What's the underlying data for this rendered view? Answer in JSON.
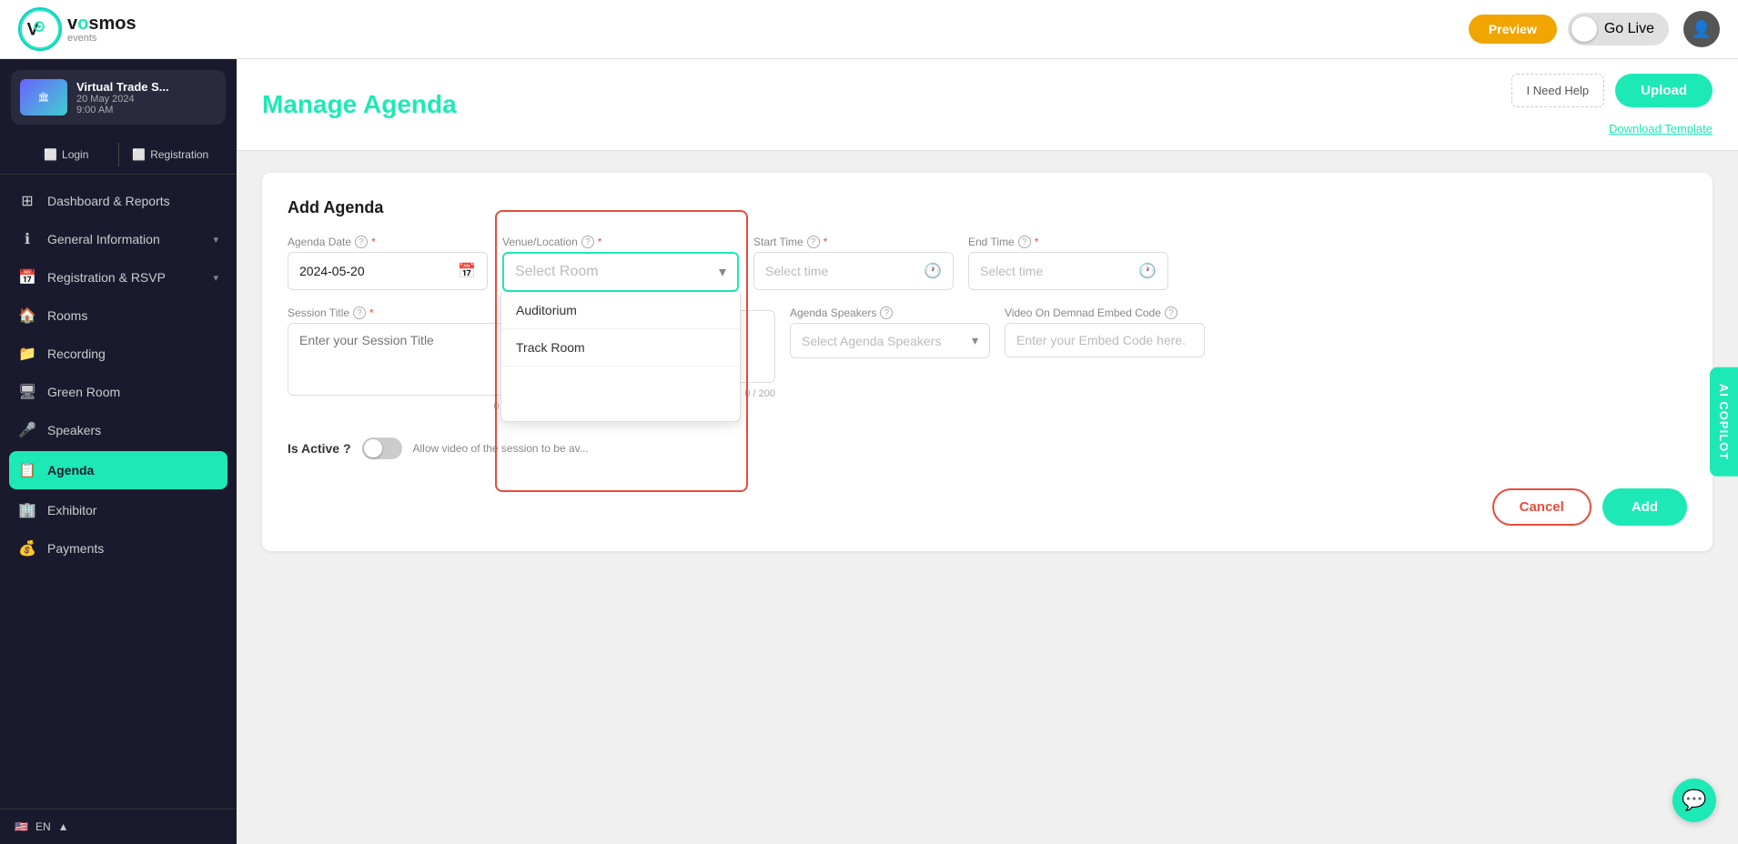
{
  "app": {
    "name": "Vosmos Events"
  },
  "topnav": {
    "preview_label": "Preview",
    "golive_label": "Go Live"
  },
  "event": {
    "title": "Virtual Trade S...",
    "date": "20 May 2024",
    "time": "9:00 AM"
  },
  "sidebar": {
    "auth": {
      "login_label": "Login",
      "registration_label": "Registration"
    },
    "items": [
      {
        "id": "dashboard",
        "label": "Dashboard & Reports",
        "icon": "⊞"
      },
      {
        "id": "general",
        "label": "General Information",
        "icon": "ℹ",
        "hasChevron": true
      },
      {
        "id": "registration",
        "label": "Registration & RSVP",
        "icon": "📅",
        "hasChevron": true
      },
      {
        "id": "rooms",
        "label": "Rooms",
        "icon": "🏠"
      },
      {
        "id": "recording",
        "label": "Recording",
        "icon": "📁"
      },
      {
        "id": "greenroom",
        "label": "Green Room",
        "icon": "🖥"
      },
      {
        "id": "speakers",
        "label": "Speakers",
        "icon": "🎤"
      },
      {
        "id": "agenda",
        "label": "Agenda",
        "icon": "📋",
        "active": true
      },
      {
        "id": "exhibitor",
        "label": "Exhibitor",
        "icon": "🏢"
      },
      {
        "id": "payments",
        "label": "Payments",
        "icon": "💰"
      }
    ],
    "lang": "EN"
  },
  "header": {
    "page_title": "Manage Agenda",
    "need_help_label": "I Need Help",
    "upload_label": "Upload",
    "download_template_label": "Download Template"
  },
  "form": {
    "card_title": "Add Agenda",
    "agenda_date_label": "Agenda Date",
    "agenda_date_value": "2024-05-20",
    "venue_label": "Venue/Location",
    "venue_placeholder": "Select Room",
    "venue_options": [
      "Auditorium",
      "Track Room"
    ],
    "start_time_label": "Start Time",
    "start_time_placeholder": "Select time",
    "end_time_label": "End Time",
    "end_time_placeholder": "Select time",
    "session_title_label": "Session Title",
    "session_title_placeholder": "Enter your Session Title",
    "session_char_count": "0 / 200",
    "session_desc_char_count": "0 / 200",
    "agenda_speakers_label": "Agenda Speakers",
    "agenda_speakers_placeholder": "Select Agenda Speakers",
    "video_embed_label": "Video On Demnad Embed Code",
    "video_embed_placeholder": "Enter your Embed Code here.",
    "is_active_label": "Is Active ?",
    "is_active_desc": "Allow video of the session to be av...",
    "cancel_label": "Cancel",
    "add_label": "Add"
  },
  "ai_copilot": {
    "label": "AI COPILOT"
  }
}
